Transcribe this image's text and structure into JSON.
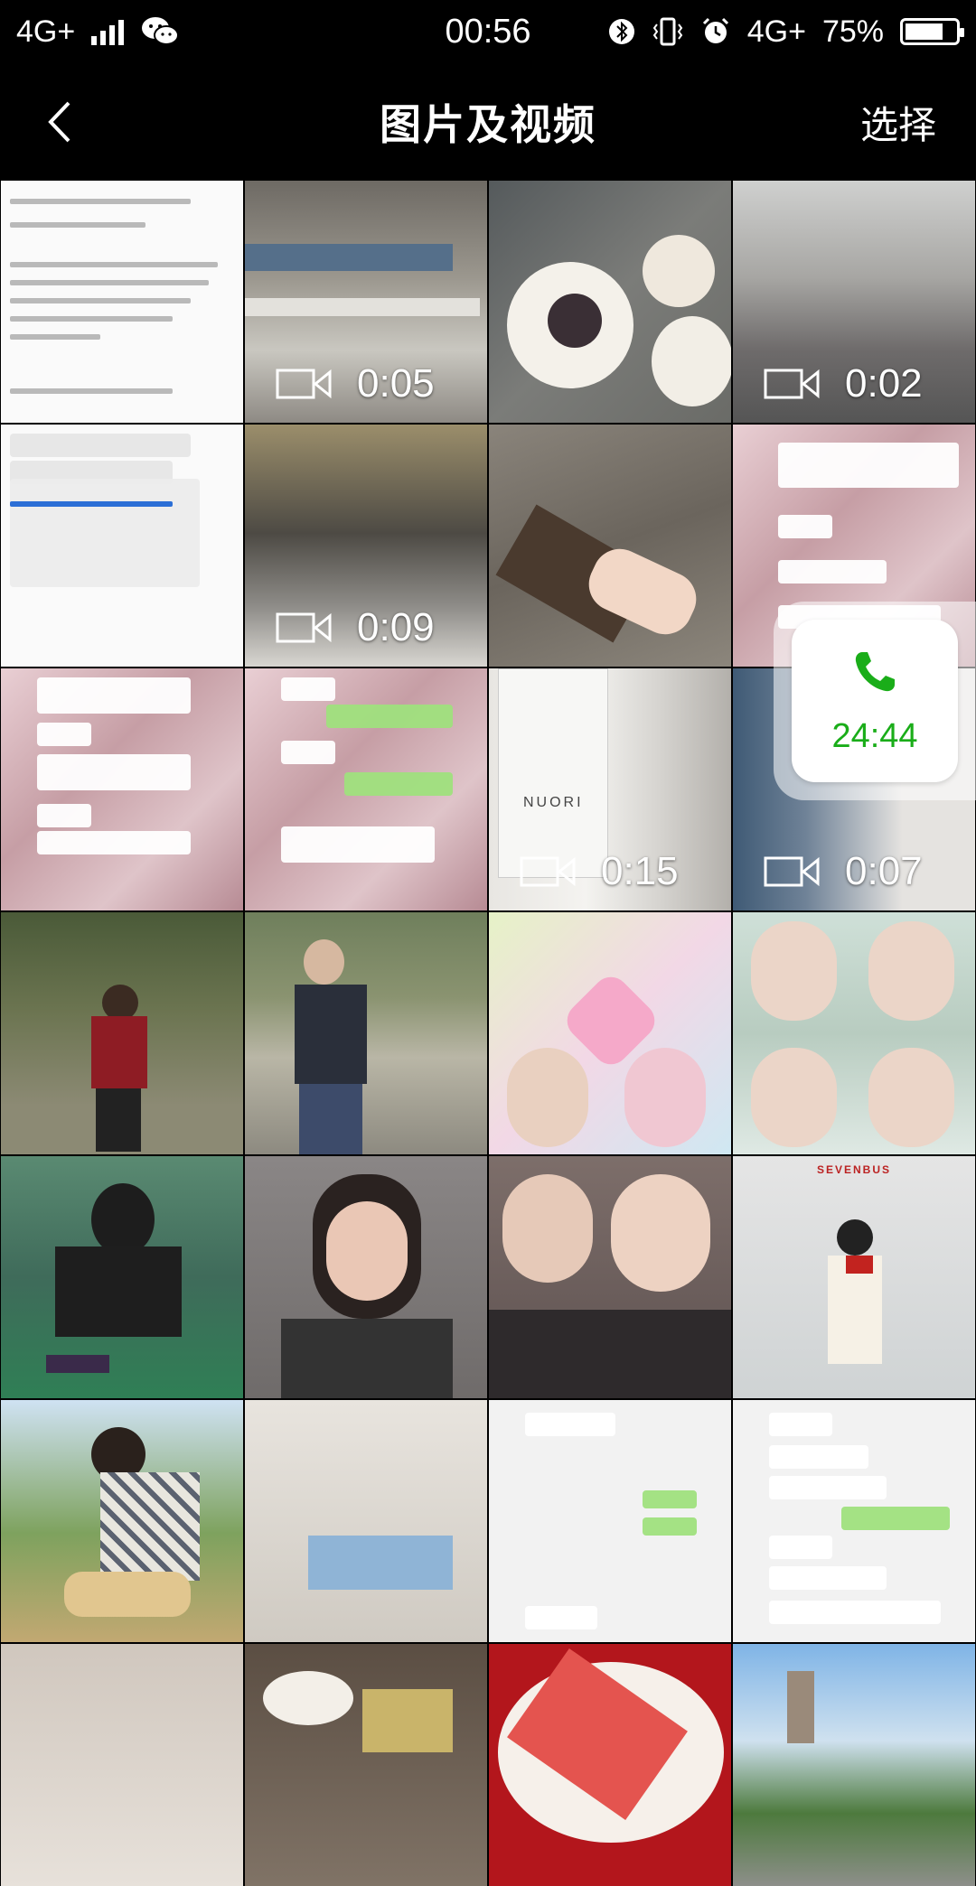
{
  "status_bar": {
    "left_network": "4G+",
    "time": "00:56",
    "right_network": "4G+",
    "battery": "75%",
    "battery_level": 0.75,
    "icons": [
      "signal-bars-icon",
      "wechat-icon",
      "bluetooth-icon",
      "vibrate-icon",
      "alarm-icon",
      "battery-icon"
    ]
  },
  "header": {
    "back_icon": "back-chevron-icon",
    "title": "图片及视频",
    "select_label": "选择"
  },
  "tiles": [
    {
      "type": "document"
    },
    {
      "type": "video",
      "duration": "0:05"
    },
    {
      "type": "photo"
    },
    {
      "type": "video",
      "duration": "0:02"
    },
    {
      "type": "document"
    },
    {
      "type": "video",
      "duration": "0:09"
    },
    {
      "type": "photo"
    },
    {
      "type": "chat"
    },
    {
      "type": "chat"
    },
    {
      "type": "chat"
    },
    {
      "type": "video",
      "duration": "0:15"
    },
    {
      "type": "video",
      "duration": "0:07"
    },
    {
      "type": "photo"
    },
    {
      "type": "photo"
    },
    {
      "type": "photo"
    },
    {
      "type": "photo"
    },
    {
      "type": "photo"
    },
    {
      "type": "photo"
    },
    {
      "type": "photo"
    },
    {
      "type": "photo"
    },
    {
      "type": "photo"
    },
    {
      "type": "photo"
    },
    {
      "type": "chat"
    },
    {
      "type": "chat"
    },
    {
      "type": "photo"
    },
    {
      "type": "photo"
    },
    {
      "type": "photo"
    },
    {
      "type": "photo"
    }
  ],
  "floating_call": {
    "icon": "phone-icon",
    "duration": "24:44"
  },
  "tile_text": {
    "nuori_label": "NUORI",
    "sevenbus_label": "SEVENBUS"
  }
}
